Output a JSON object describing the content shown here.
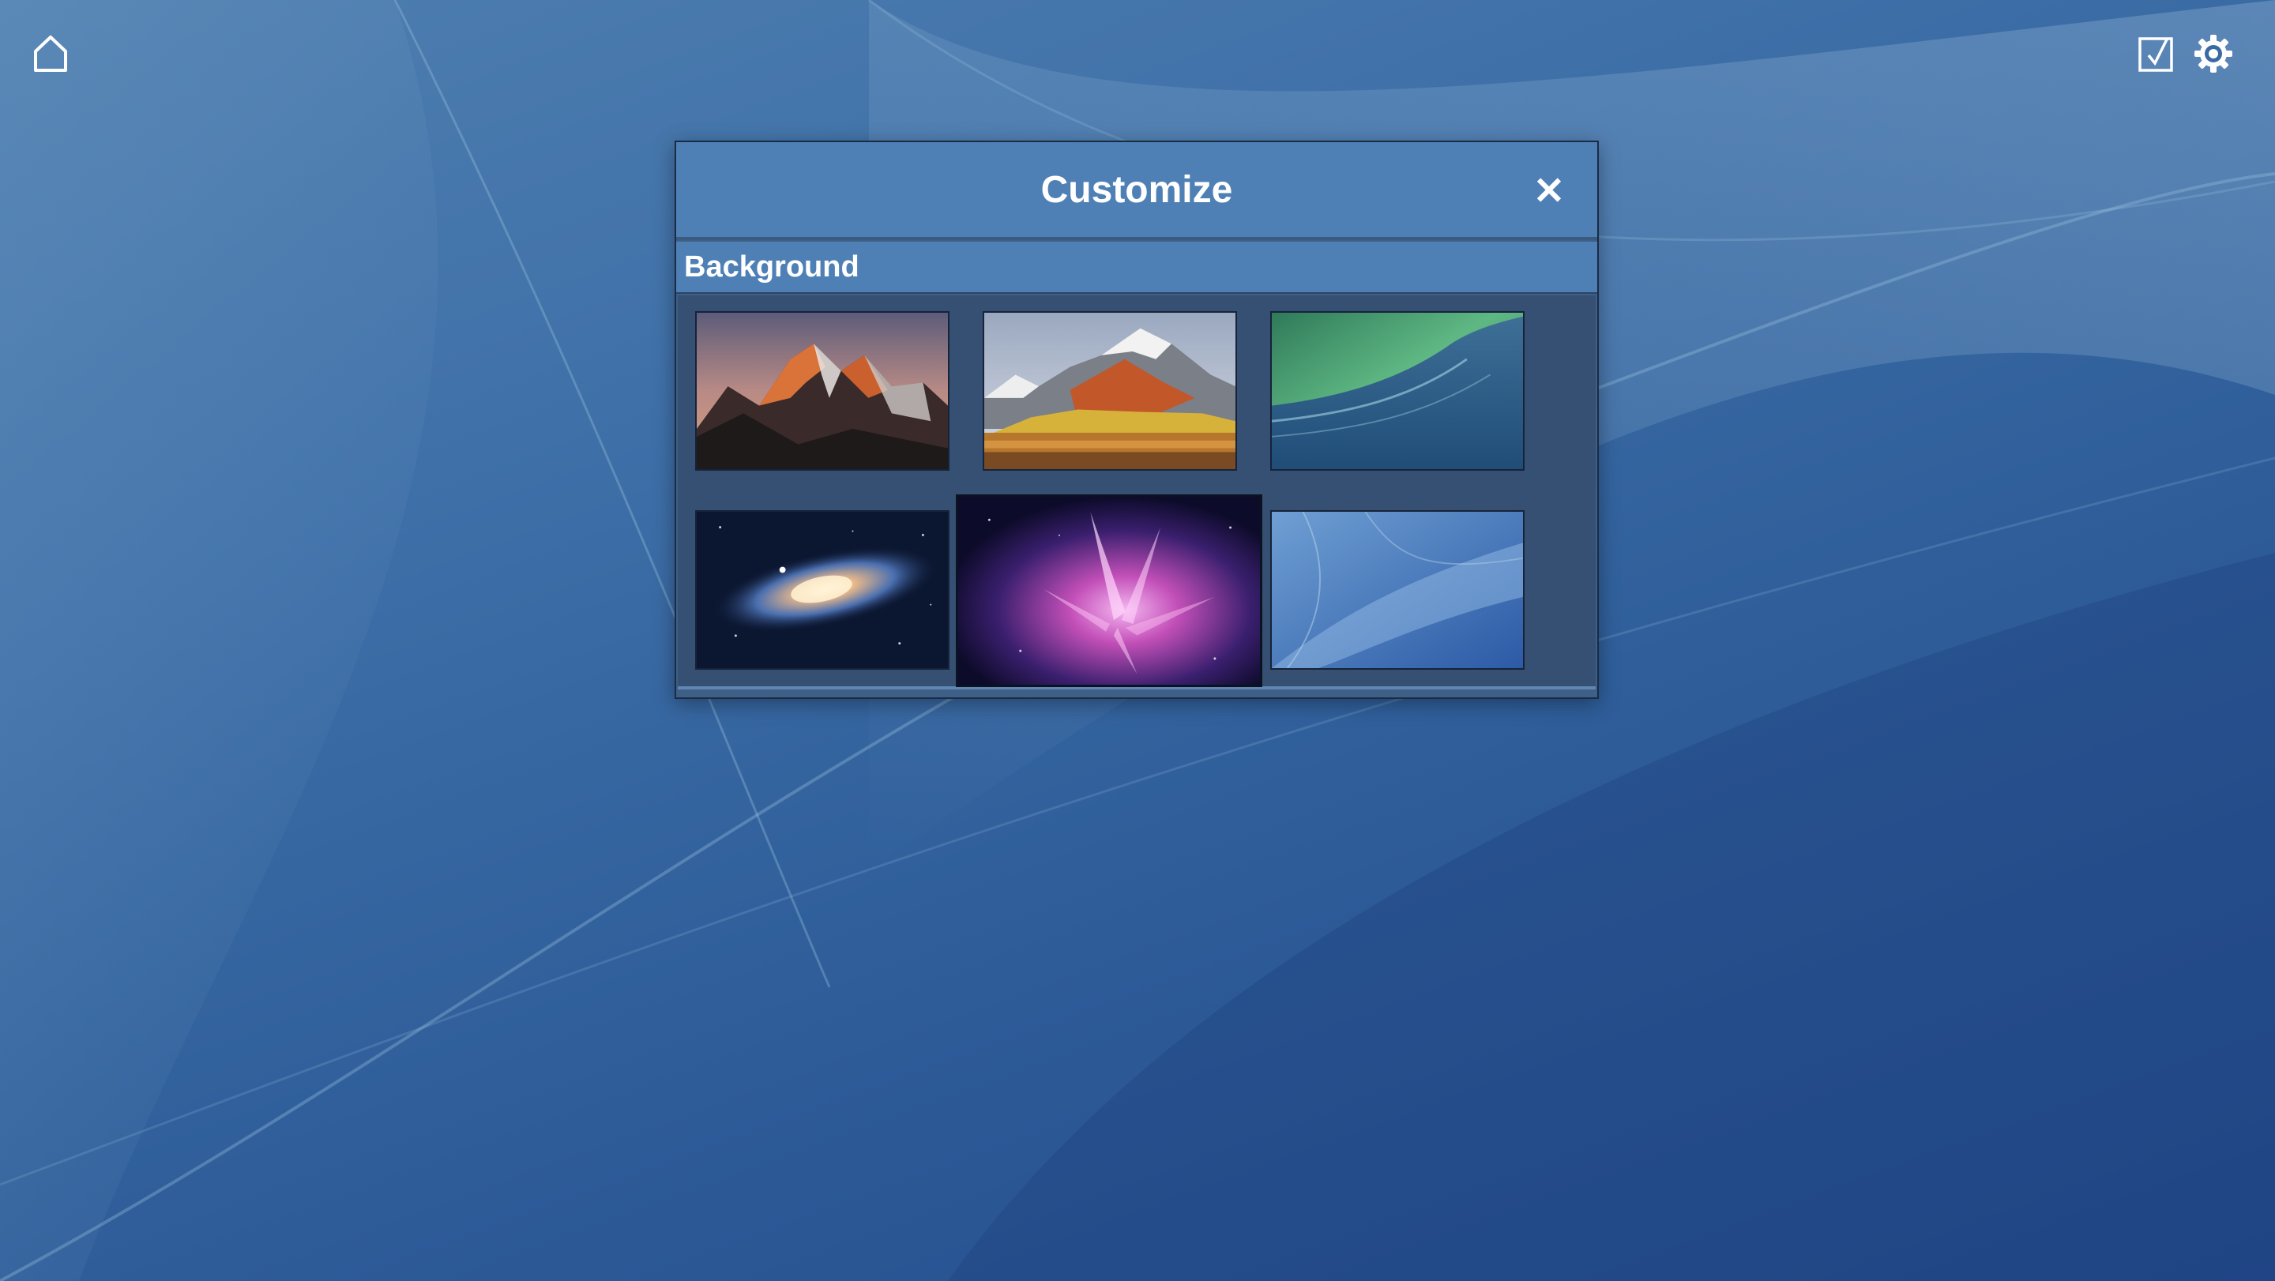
{
  "toolbar": {
    "home_icon": "home-icon",
    "tasks_icon": "checkbox-icon",
    "settings_icon": "gear-icon"
  },
  "dialog": {
    "title": "Customize",
    "close_label": "✕",
    "section_title": "Background",
    "backgrounds": [
      {
        "name": "mountain-sunset"
      },
      {
        "name": "autumn-lake-mountains"
      },
      {
        "name": "green-wave"
      },
      {
        "name": "galaxy"
      },
      {
        "name": "purple-aurora",
        "selected": true
      },
      {
        "name": "blue-abstract"
      }
    ]
  },
  "colors": {
    "header": "#4f80b5",
    "desktop": "#3f70a8",
    "border": "#1a2b45"
  }
}
